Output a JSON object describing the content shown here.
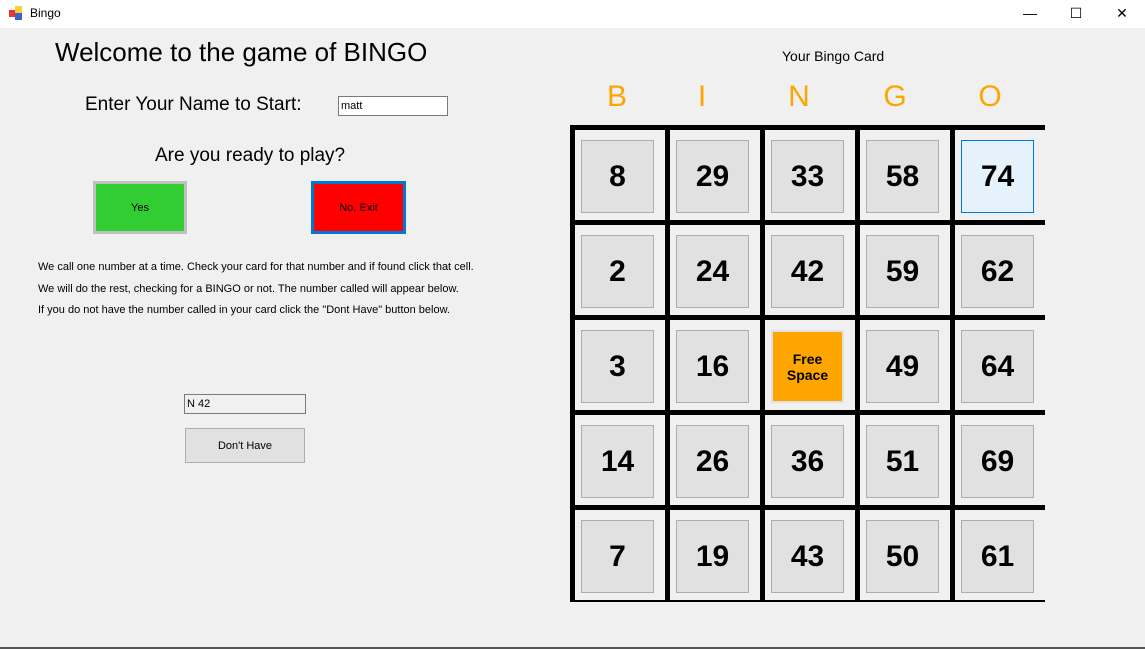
{
  "window": {
    "title": "Bingo",
    "minimize": "—",
    "maximize": "☐",
    "close": "✕"
  },
  "left": {
    "welcome": "Welcome to the game of BINGO",
    "name_label": "Enter Your Name to Start:",
    "name_value": "matt",
    "ready": "Are you ready to play?",
    "yes_label": "Yes",
    "no_label": "No, Exit",
    "instructions": [
      "We call one number at a time. Check your card for that number and if found click that cell.",
      "We will do the rest, checking for a BINGO or not. The number called will appear below.",
      "If you do not have the number called in your card click the \"Dont Have\" button below."
    ],
    "called_number": "N 42",
    "dont_have_label": "Don't Have"
  },
  "card": {
    "title": "Your Bingo Card",
    "letters": [
      "B",
      "I",
      "N",
      "G",
      "O"
    ],
    "rows": [
      [
        "8",
        "29",
        "33",
        "58",
        "74"
      ],
      [
        "2",
        "24",
        "42",
        "59",
        "62"
      ],
      [
        "3",
        "16",
        "Free Space",
        "49",
        "64"
      ],
      [
        "14",
        "26",
        "36",
        "51",
        "69"
      ],
      [
        "7",
        "19",
        "43",
        "50",
        "61"
      ]
    ],
    "hovered_cell": "74",
    "colors": {
      "letters": "#ffa500",
      "free_space": "#ffa500",
      "yes": "#32cd32",
      "no": "#ff0000"
    }
  }
}
